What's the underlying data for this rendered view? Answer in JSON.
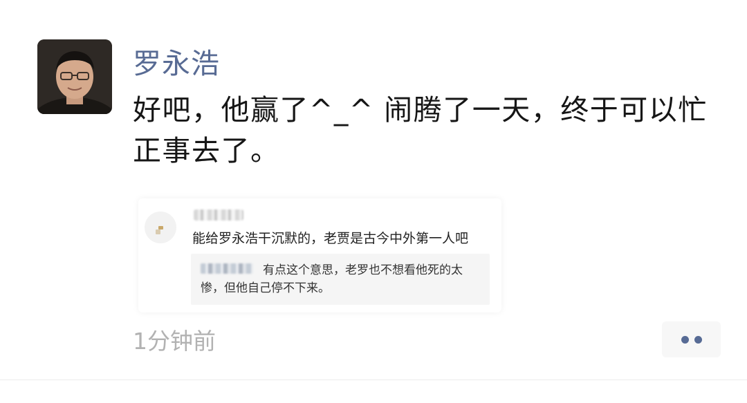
{
  "post": {
    "author_name": "罗永浩",
    "text": "好吧，他赢了^_^ 闹腾了一天，终于可以忙正事去了。",
    "timestamp": "1分钟前"
  },
  "quoted_comment": {
    "comment_text": "能给罗永浩干沉默的，老贾是古今中外第一人吧",
    "reply_text": "有点这个意思，老罗也不想看他死的太惨，但他自己停不下来。"
  },
  "colors": {
    "author_name": "#586b94",
    "timestamp": "#b2b2b2",
    "more_dots": "#576b95"
  },
  "icons": {
    "more_button": "more-dots-icon"
  }
}
